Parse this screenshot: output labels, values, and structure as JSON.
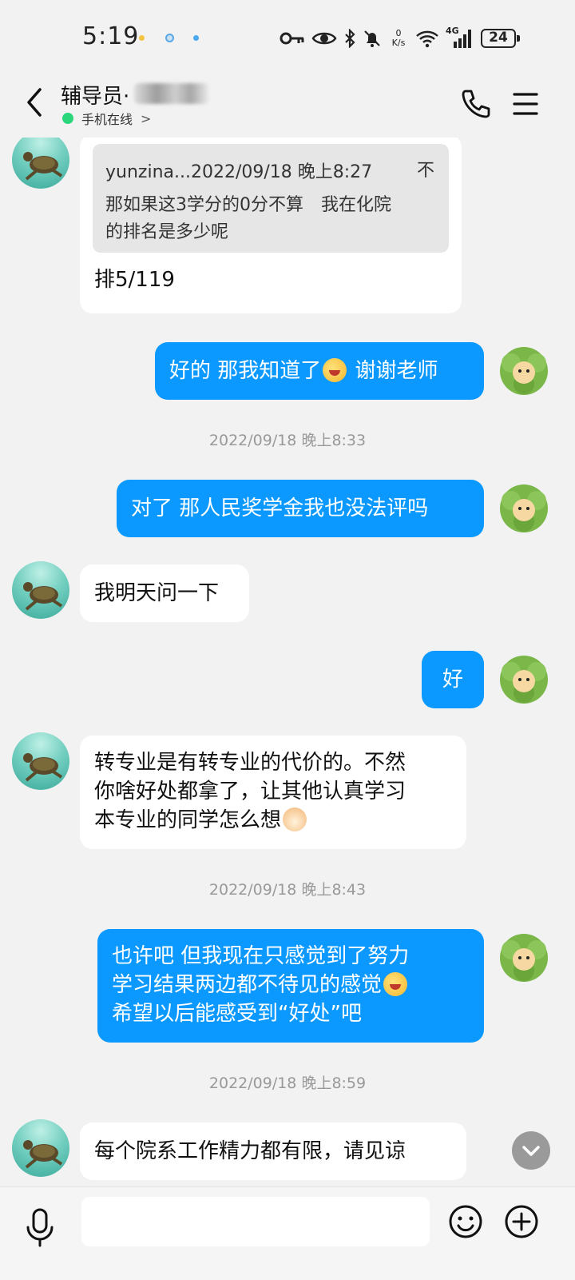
{
  "status_bar": {
    "time": "5:19",
    "net_speed_value": "0",
    "net_speed_unit": "K/s",
    "network_type": "4G",
    "battery": "24"
  },
  "header": {
    "contact_name": "辅导员·",
    "online_status": "手机在线",
    "online_chevron": ">"
  },
  "messages": {
    "m1": {
      "quote_header": "yunzina...2022/09/18 晚上8:27",
      "quote_close": "不",
      "quote_body": "那如果这3学分的0分不算　我在化院\n的排名是多少呢",
      "text": "排5/119"
    },
    "m2": {
      "text_a": "好的 那我知道了",
      "text_b": " 谢谢老师"
    },
    "ts1": "2022/09/18 晚上8:33",
    "m3": {
      "text": "对了 那人民奖学金我也没法评吗"
    },
    "m4": {
      "text": "我明天问一下"
    },
    "m5": {
      "text": "好"
    },
    "m6": {
      "text": "转专业是有转专业的代价的。不然\n你啥好处都拿了，让其他认真学习\n本专业的同学怎么想"
    },
    "ts2": "2022/09/18 晚上8:43",
    "m7": {
      "text_a": "也许吧 但我现在只感觉到了努力\n学习结果两边都不待见的感觉",
      "text_b": "\n希望以后能感受到“好处”吧"
    },
    "ts3": "2022/09/18 晚上8:59",
    "m8": {
      "text": "每个院系工作精力都有限，请见谅"
    }
  },
  "icons": {
    "back": "back-arrow-icon",
    "phone": "phone-icon",
    "menu": "menu-icon",
    "mic": "microphone-icon",
    "emoji": "smiley-icon",
    "plus": "plus-circle-icon",
    "scroll": "chevron-down-icon"
  },
  "colors": {
    "outgoing_bubble": "#0b99ff",
    "incoming_bubble": "#ffffff",
    "background": "#f2f2f2",
    "online_dot": "#2bd67b"
  }
}
